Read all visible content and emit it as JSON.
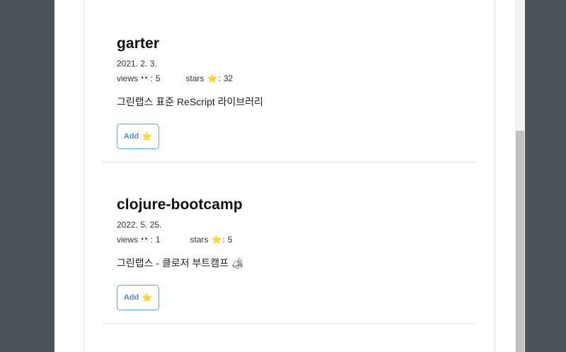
{
  "posts": [
    {
      "title": "garter",
      "date": "2021. 2. 3.",
      "views_label": "views",
      "views_icon": "👀",
      "views_sep": ":",
      "views": "5",
      "stars_label": "stars",
      "stars_icon": "⭐",
      "stars_sep": ":",
      "stars": "32",
      "description": "그린랩스 표준 ReScript 라이브러리",
      "add_label": "Add",
      "add_icon": "⭐"
    },
    {
      "title": "clojure-bootcamp",
      "date": "2022. 5. 25.",
      "views_label": "views",
      "views_icon": "👀",
      "views_sep": ":",
      "views": "1",
      "stars_label": "stars",
      "stars_icon": "⭐",
      "stars_sep": ":",
      "stars": "5",
      "description": "그린랩스 - 클로저 부트캠프 🏕",
      "add_label": "Add",
      "add_icon": "⭐"
    }
  ],
  "colors": {
    "backdrop": "#4b545b",
    "accent": "#5ea3e6",
    "star": "#f5d06a"
  }
}
